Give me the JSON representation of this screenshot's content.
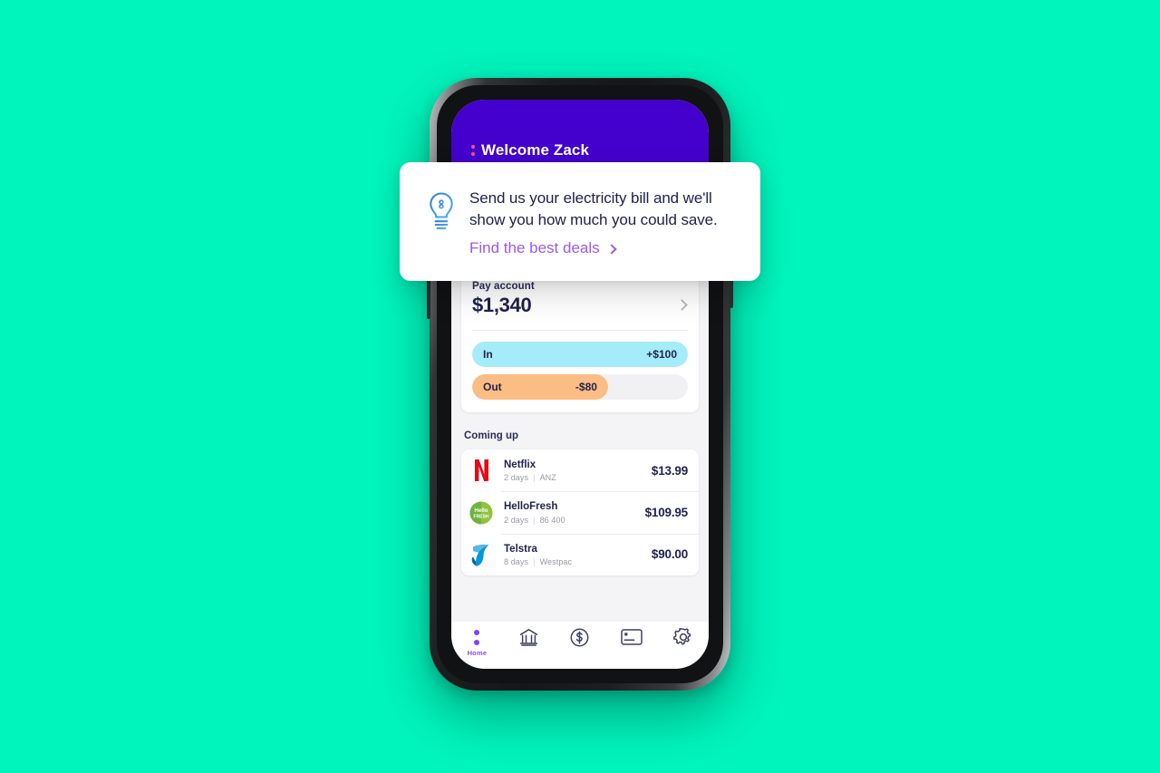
{
  "background_color": "#00f5bd",
  "phone": {
    "header": {
      "bg_color": "#4401cd",
      "accent_dot_color": "#ff4d8d",
      "welcome_title": "Welcome Zack"
    },
    "pay_account": {
      "label": "Pay account",
      "balance": "$1,340",
      "chevron": "chevron-right-icon",
      "flows": [
        {
          "label": "In",
          "amount": "+$100",
          "fill_percent": 100,
          "color": "#a5ecfa"
        },
        {
          "label": "Out",
          "amount": "-$80",
          "fill_percent": 63,
          "color": "#fcbd84"
        }
      ]
    },
    "coming_up": {
      "title": "Coming up",
      "items": [
        {
          "merchant": "Netflix",
          "due": "2 days",
          "account": "ANZ",
          "amount": "$13.99",
          "logo": "netflix-logo"
        },
        {
          "merchant": "HelloFresh",
          "due": "2 days",
          "account": "86 400",
          "amount": "$109.95",
          "logo": "hellofresh-logo"
        },
        {
          "merchant": "Telstra",
          "due": "8 days",
          "account": "Westpac",
          "amount": "$90.00",
          "logo": "telstra-logo"
        }
      ]
    },
    "tab_bar": {
      "active_color": "#8c3df0",
      "items": [
        {
          "icon": "home-dots-icon",
          "label": "Home"
        },
        {
          "icon": "bank-building-icon",
          "label": ""
        },
        {
          "icon": "dollar-circle-icon",
          "label": ""
        },
        {
          "icon": "card-icon",
          "label": ""
        },
        {
          "icon": "gear-icon",
          "label": ""
        }
      ]
    }
  },
  "notification": {
    "icon": "lightbulb-icon",
    "message": "Send us your electricity bill and we'll show you how much you could save.",
    "cta_label": "Find the best deals",
    "cta_color": "#9b59f0"
  }
}
